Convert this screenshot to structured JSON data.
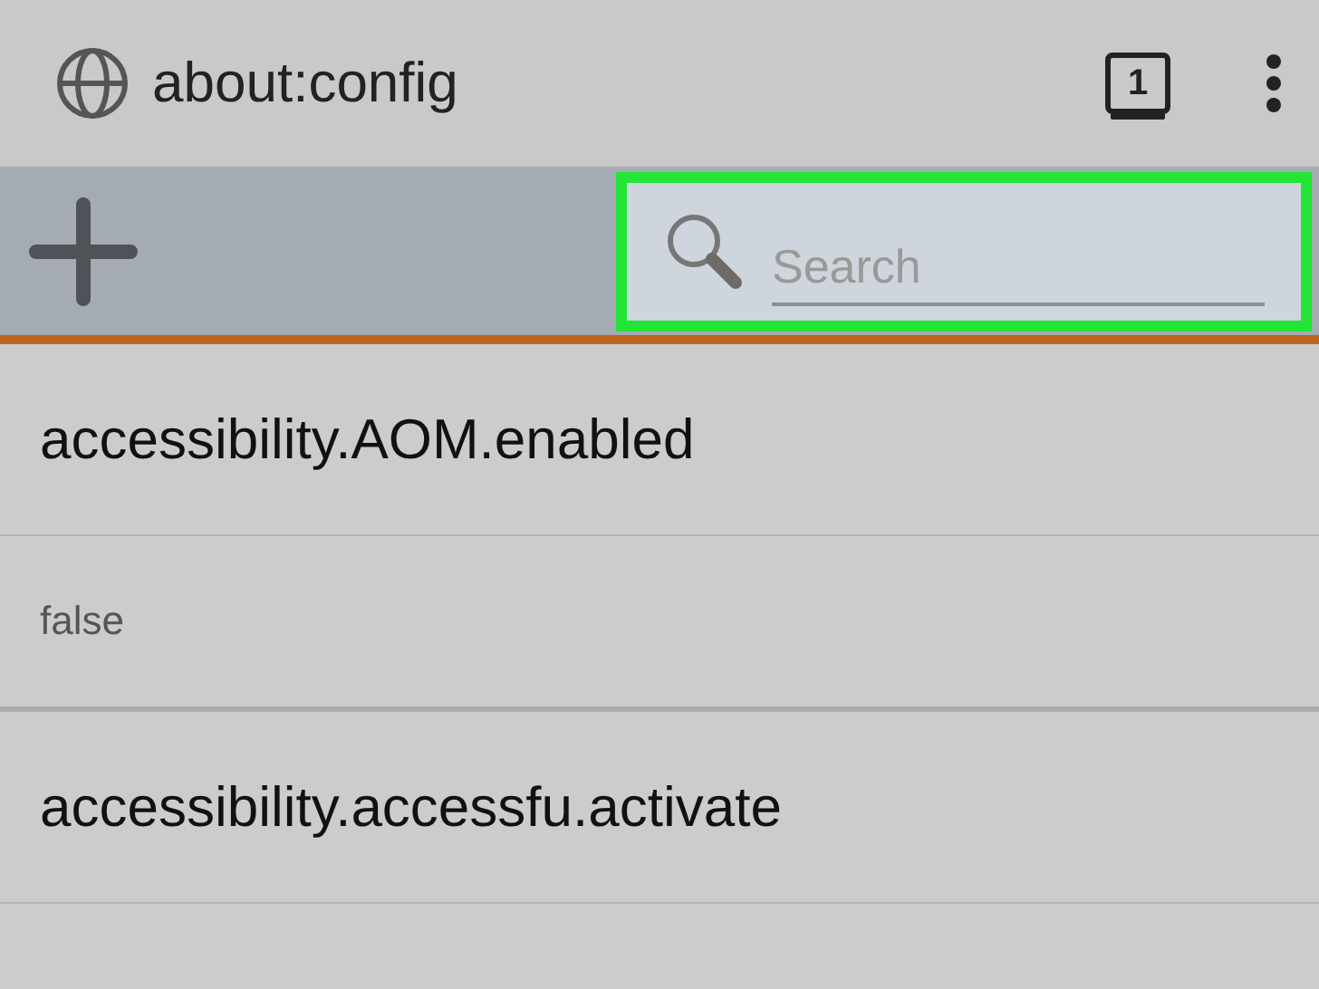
{
  "address_bar": {
    "url": "about:config",
    "tab_count": "1"
  },
  "toolbar": {
    "search": {
      "placeholder": "Search"
    }
  },
  "preferences": [
    {
      "name": "accessibility.AOM.enabled",
      "value": "false"
    },
    {
      "name": "accessibility.accessfu.activate"
    }
  ]
}
